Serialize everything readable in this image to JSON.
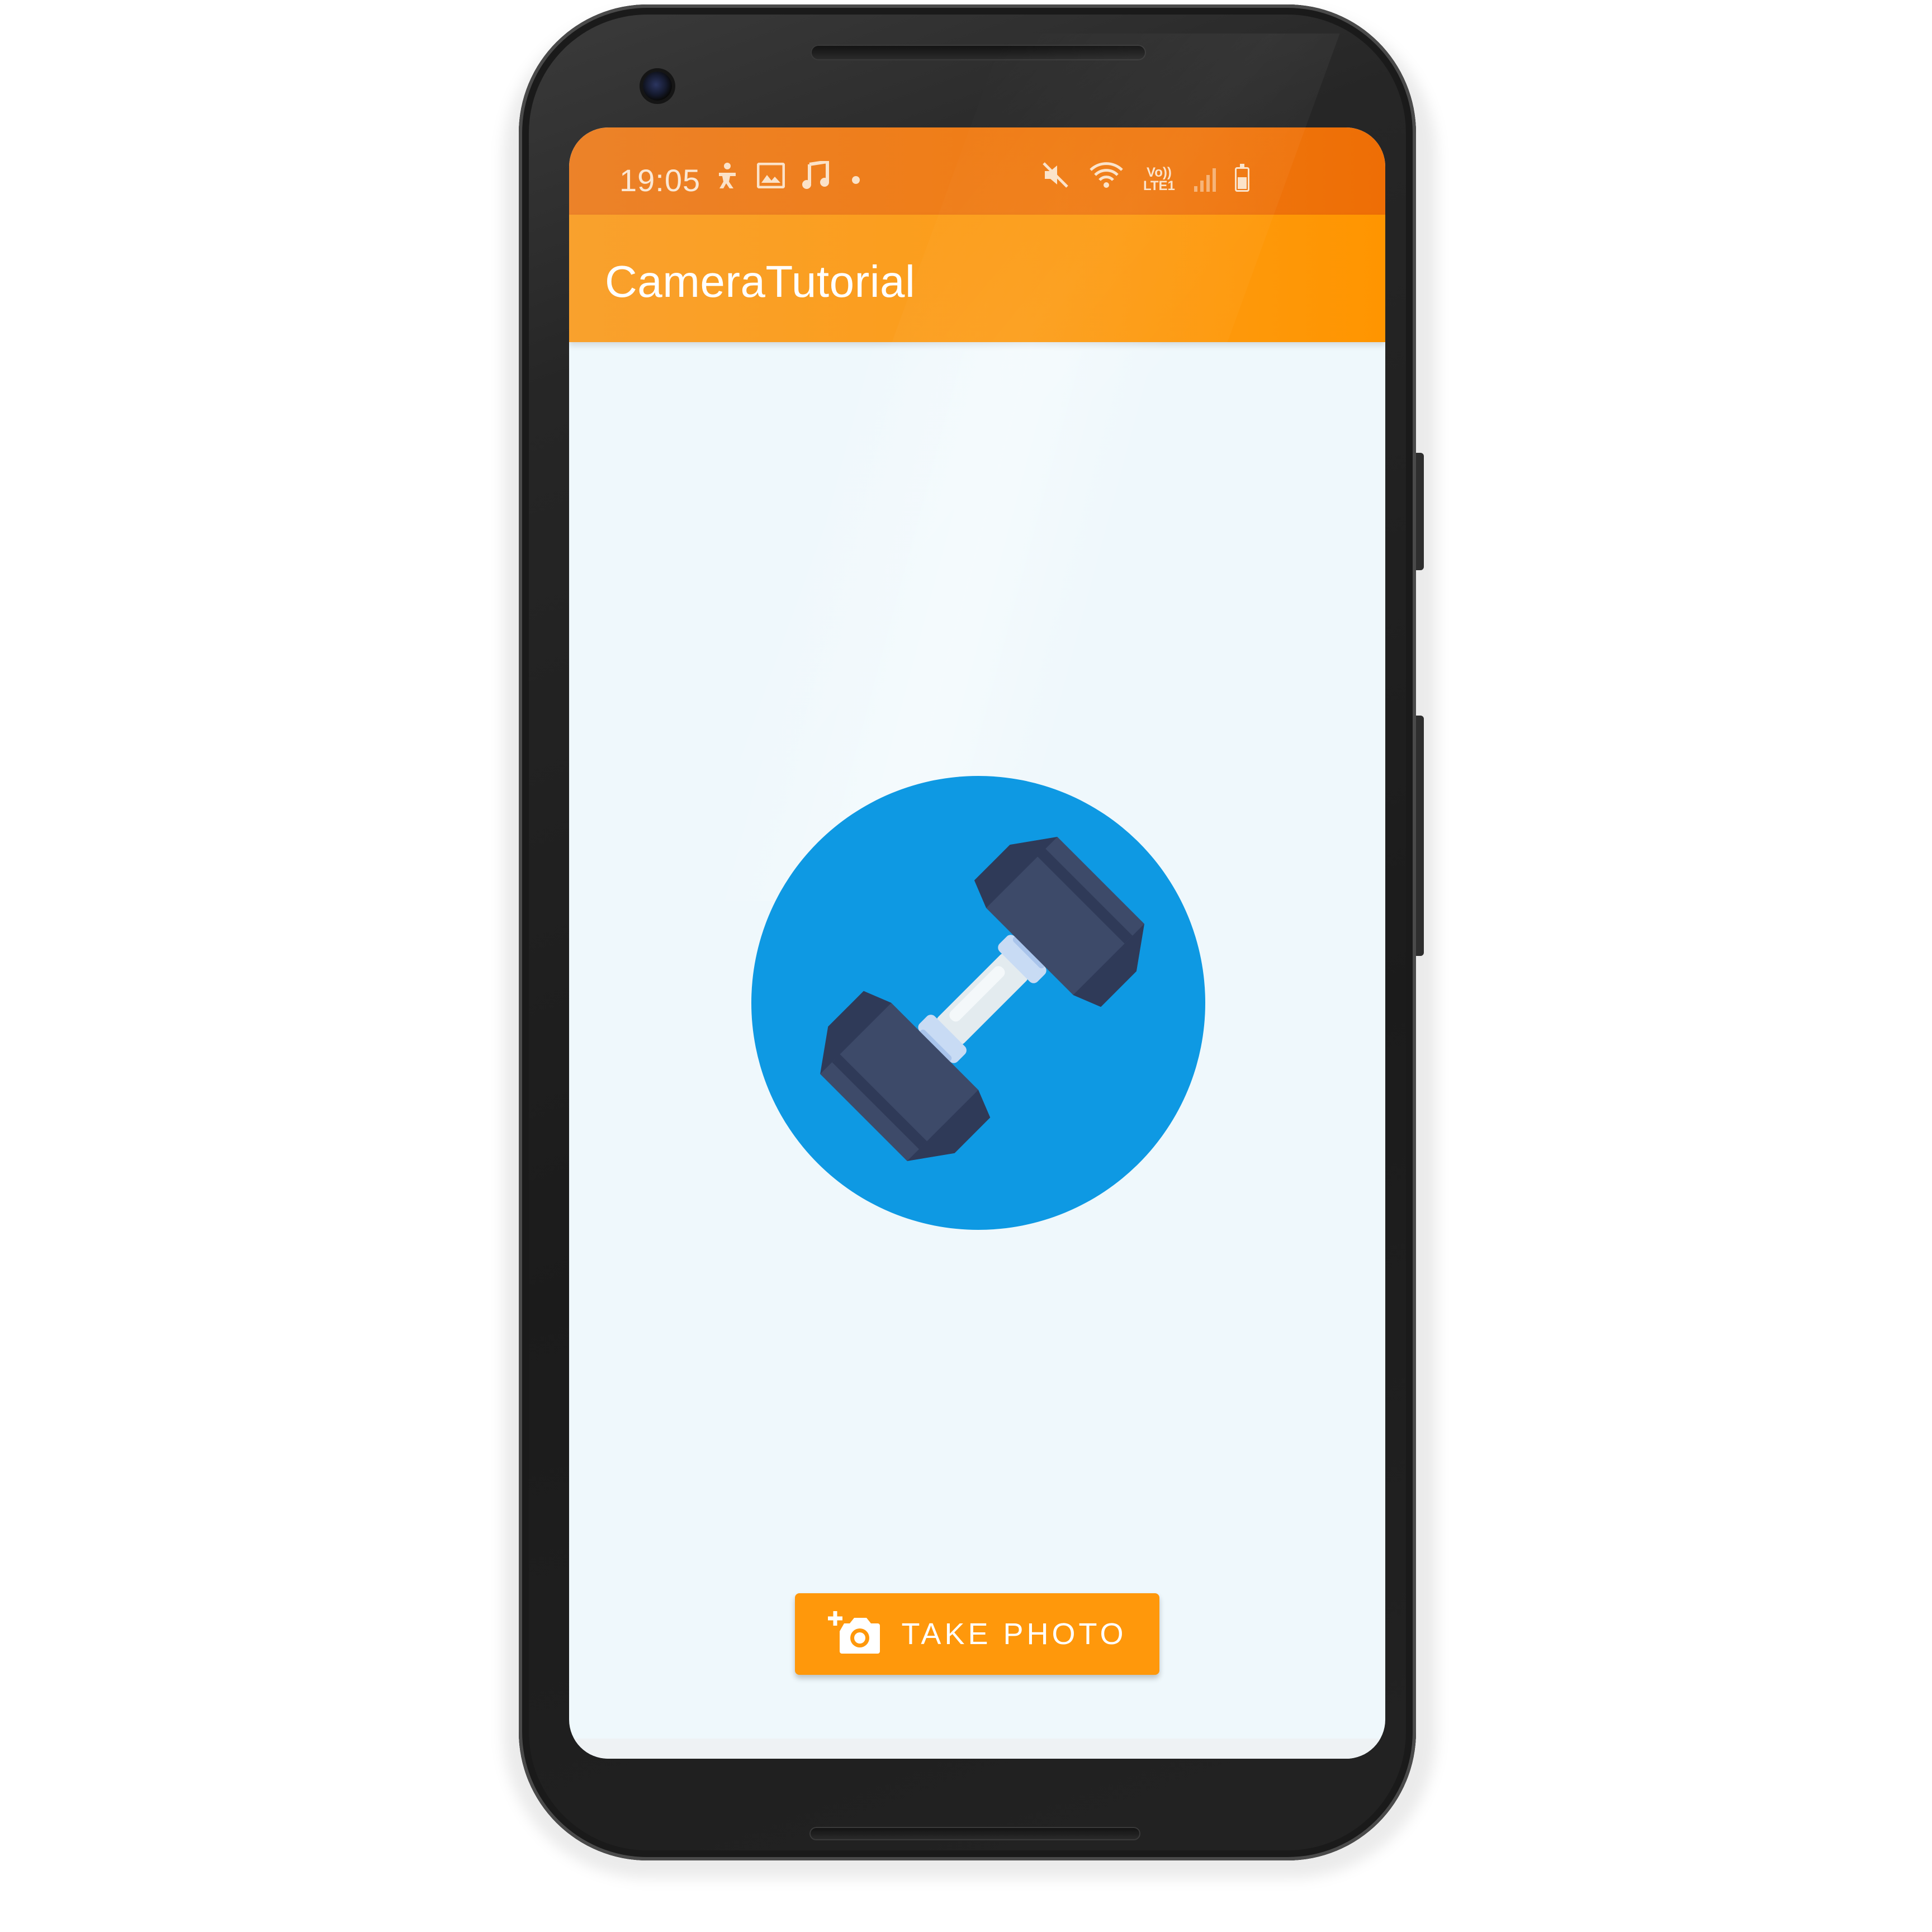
{
  "status_bar": {
    "time": "19:05",
    "left_icons": [
      "accessibility-icon",
      "image-icon",
      "music-note-icon",
      "notification-dot"
    ],
    "right_icons": [
      "mute-icon",
      "wifi-icon",
      "volte-icon",
      "signal-icon",
      "battery-icon"
    ],
    "volte_top": "Vo))",
    "volte_bottom": "LTE1"
  },
  "app_bar": {
    "title": "CameraTutorial"
  },
  "content": {
    "hero_icon": "dumbbell-icon"
  },
  "take_photo_button": {
    "label": "TAKE PHOTO",
    "icon": "add-photo-camera-icon"
  },
  "colors": {
    "status_bar": "#ee7a14",
    "app_bar": "#fc9d19",
    "button": "#ff980b",
    "background": "#eff8fc",
    "hero_circle": "#0e99e3",
    "dumbbell_weight": "#3d4a69"
  }
}
